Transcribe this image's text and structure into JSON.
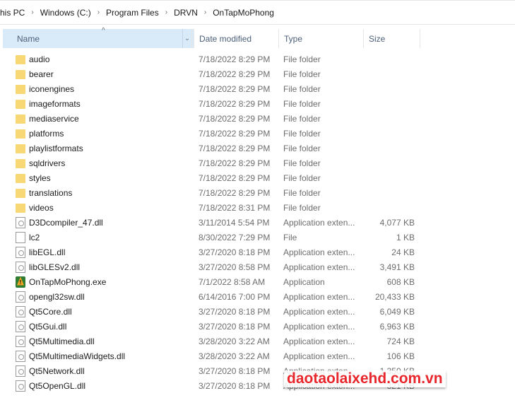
{
  "breadcrumb": [
    "his PC",
    "Windows (C:)",
    "Program Files",
    "DRVN",
    "OnTapMoPhong"
  ],
  "columns": {
    "name": "Name",
    "date": "Date modified",
    "type": "Type",
    "size": "Size"
  },
  "files": [
    {
      "icon": "folder",
      "name": "audio",
      "date": "7/18/2022 8:29 PM",
      "type": "File folder",
      "size": ""
    },
    {
      "icon": "folder",
      "name": "bearer",
      "date": "7/18/2022 8:29 PM",
      "type": "File folder",
      "size": ""
    },
    {
      "icon": "folder",
      "name": "iconengines",
      "date": "7/18/2022 8:29 PM",
      "type": "File folder",
      "size": ""
    },
    {
      "icon": "folder",
      "name": "imageformats",
      "date": "7/18/2022 8:29 PM",
      "type": "File folder",
      "size": ""
    },
    {
      "icon": "folder",
      "name": "mediaservice",
      "date": "7/18/2022 8:29 PM",
      "type": "File folder",
      "size": ""
    },
    {
      "icon": "folder",
      "name": "platforms",
      "date": "7/18/2022 8:29 PM",
      "type": "File folder",
      "size": ""
    },
    {
      "icon": "folder",
      "name": "playlistformats",
      "date": "7/18/2022 8:29 PM",
      "type": "File folder",
      "size": ""
    },
    {
      "icon": "folder",
      "name": "sqldrivers",
      "date": "7/18/2022 8:29 PM",
      "type": "File folder",
      "size": ""
    },
    {
      "icon": "folder",
      "name": "styles",
      "date": "7/18/2022 8:29 PM",
      "type": "File folder",
      "size": ""
    },
    {
      "icon": "folder",
      "name": "translations",
      "date": "7/18/2022 8:29 PM",
      "type": "File folder",
      "size": ""
    },
    {
      "icon": "folder",
      "name": "videos",
      "date": "7/18/2022 8:31 PM",
      "type": "File folder",
      "size": ""
    },
    {
      "icon": "dll",
      "name": "D3Dcompiler_47.dll",
      "date": "3/11/2014 5:54 PM",
      "type": "Application exten...",
      "size": "4,077 KB"
    },
    {
      "icon": "file",
      "name": "lc2",
      "date": "8/30/2022 7:29 PM",
      "type": "File",
      "size": "1 KB"
    },
    {
      "icon": "dll",
      "name": "libEGL.dll",
      "date": "3/27/2020 8:18 PM",
      "type": "Application exten...",
      "size": "24 KB"
    },
    {
      "icon": "dll",
      "name": "libGLESv2.dll",
      "date": "3/27/2020 8:58 PM",
      "type": "Application exten...",
      "size": "3,491 KB"
    },
    {
      "icon": "exe",
      "name": "OnTapMoPhong.exe",
      "date": "7/1/2022 8:58 AM",
      "type": "Application",
      "size": "608 KB"
    },
    {
      "icon": "dll",
      "name": "opengl32sw.dll",
      "date": "6/14/2016 7:00 PM",
      "type": "Application exten...",
      "size": "20,433 KB"
    },
    {
      "icon": "dll",
      "name": "Qt5Core.dll",
      "date": "3/27/2020 8:18 PM",
      "type": "Application exten...",
      "size": "6,049 KB"
    },
    {
      "icon": "dll",
      "name": "Qt5Gui.dll",
      "date": "3/27/2020 8:18 PM",
      "type": "Application exten...",
      "size": "6,963 KB"
    },
    {
      "icon": "dll",
      "name": "Qt5Multimedia.dll",
      "date": "3/28/2020 3:22 AM",
      "type": "Application exten...",
      "size": "724 KB"
    },
    {
      "icon": "dll",
      "name": "Qt5MultimediaWidgets.dll",
      "date": "3/28/2020 3:22 AM",
      "type": "Application exten...",
      "size": "106 KB"
    },
    {
      "icon": "dll",
      "name": "Qt5Network.dll",
      "date": "3/27/2020 8:18 PM",
      "type": "Application exten...",
      "size": "1,350 KB"
    },
    {
      "icon": "dll",
      "name": "Qt5OpenGL.dll",
      "date": "3/27/2020 8:18 PM",
      "type": "Application exten...",
      "size": "321 KB"
    }
  ],
  "watermark": "daotaolaixehd.com.vn"
}
